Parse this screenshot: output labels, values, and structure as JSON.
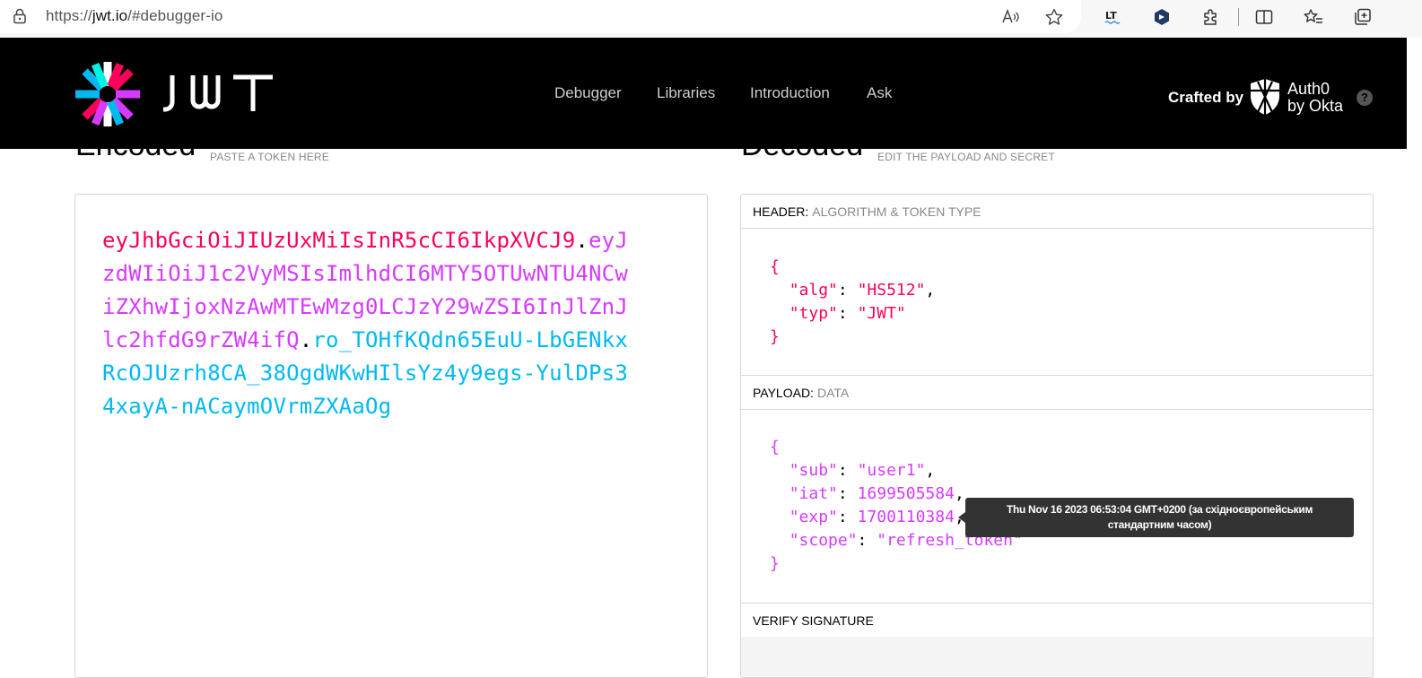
{
  "browser": {
    "url_prefix": "https://",
    "url_host": "jwt.io",
    "url_path": "/#debugger-io"
  },
  "header": {
    "logo_text": "JWT",
    "nav": [
      "Debugger",
      "Libraries",
      "Introduction",
      "Ask"
    ],
    "crafted_by": "Crafted by",
    "auth0_line1": "Auth0",
    "auth0_line2": "by Okta",
    "help": "?"
  },
  "encoded": {
    "title": "Encoded",
    "subtitle": "PASTE A TOKEN HERE",
    "token_header": "eyJhbGciOiJIUzUxMiIsInR5cCI6IkpXVCJ9",
    "token_payload": "eyJzdWIiOiJ1c2VyMSIsImlhdCI6MTY5OTUwNTU4NCwiZXhwIjoxNzAwMTEwMzg0LCJzY29wZSI6InJlZnJlc2hfdG9rZW4ifQ",
    "token_signature": "ro_TOHfKQdn65EuU-LbGENkxRcOJUzrh8CA_38OgdWKwHIlsYz4y9egs-YulDPs34xayA-nACaymOVrmZXAaOg",
    "dot": "."
  },
  "decoded": {
    "title": "Decoded",
    "subtitle": "EDIT THE PAYLOAD AND SECRET",
    "header_label": "HEADER:",
    "header_desc": "ALGORITHM & TOKEN TYPE",
    "payload_label": "PAYLOAD:",
    "payload_desc": "DATA",
    "verify_label": "VERIFY SIGNATURE",
    "header_json": {
      "open": "{",
      "alg_key": "\"alg\"",
      "alg_val": "\"HS512\"",
      "typ_key": "\"typ\"",
      "typ_val": "\"JWT\"",
      "close": "}"
    },
    "payload_json": {
      "open": "{",
      "sub_key": "\"sub\"",
      "sub_val": "\"user1\"",
      "iat_key": "\"iat\"",
      "iat_val": "1699505584",
      "exp_key": "\"exp\"",
      "exp_val": "1700110384",
      "scope_key": "\"scope\"",
      "scope_val": "\"refresh_token\"",
      "close": "}"
    }
  },
  "tooltip": {
    "line1": "Thu Nov 16 2023 06:53:04 GMT+0200 (за східноєвропейським",
    "line2": "стандартним часом)"
  }
}
